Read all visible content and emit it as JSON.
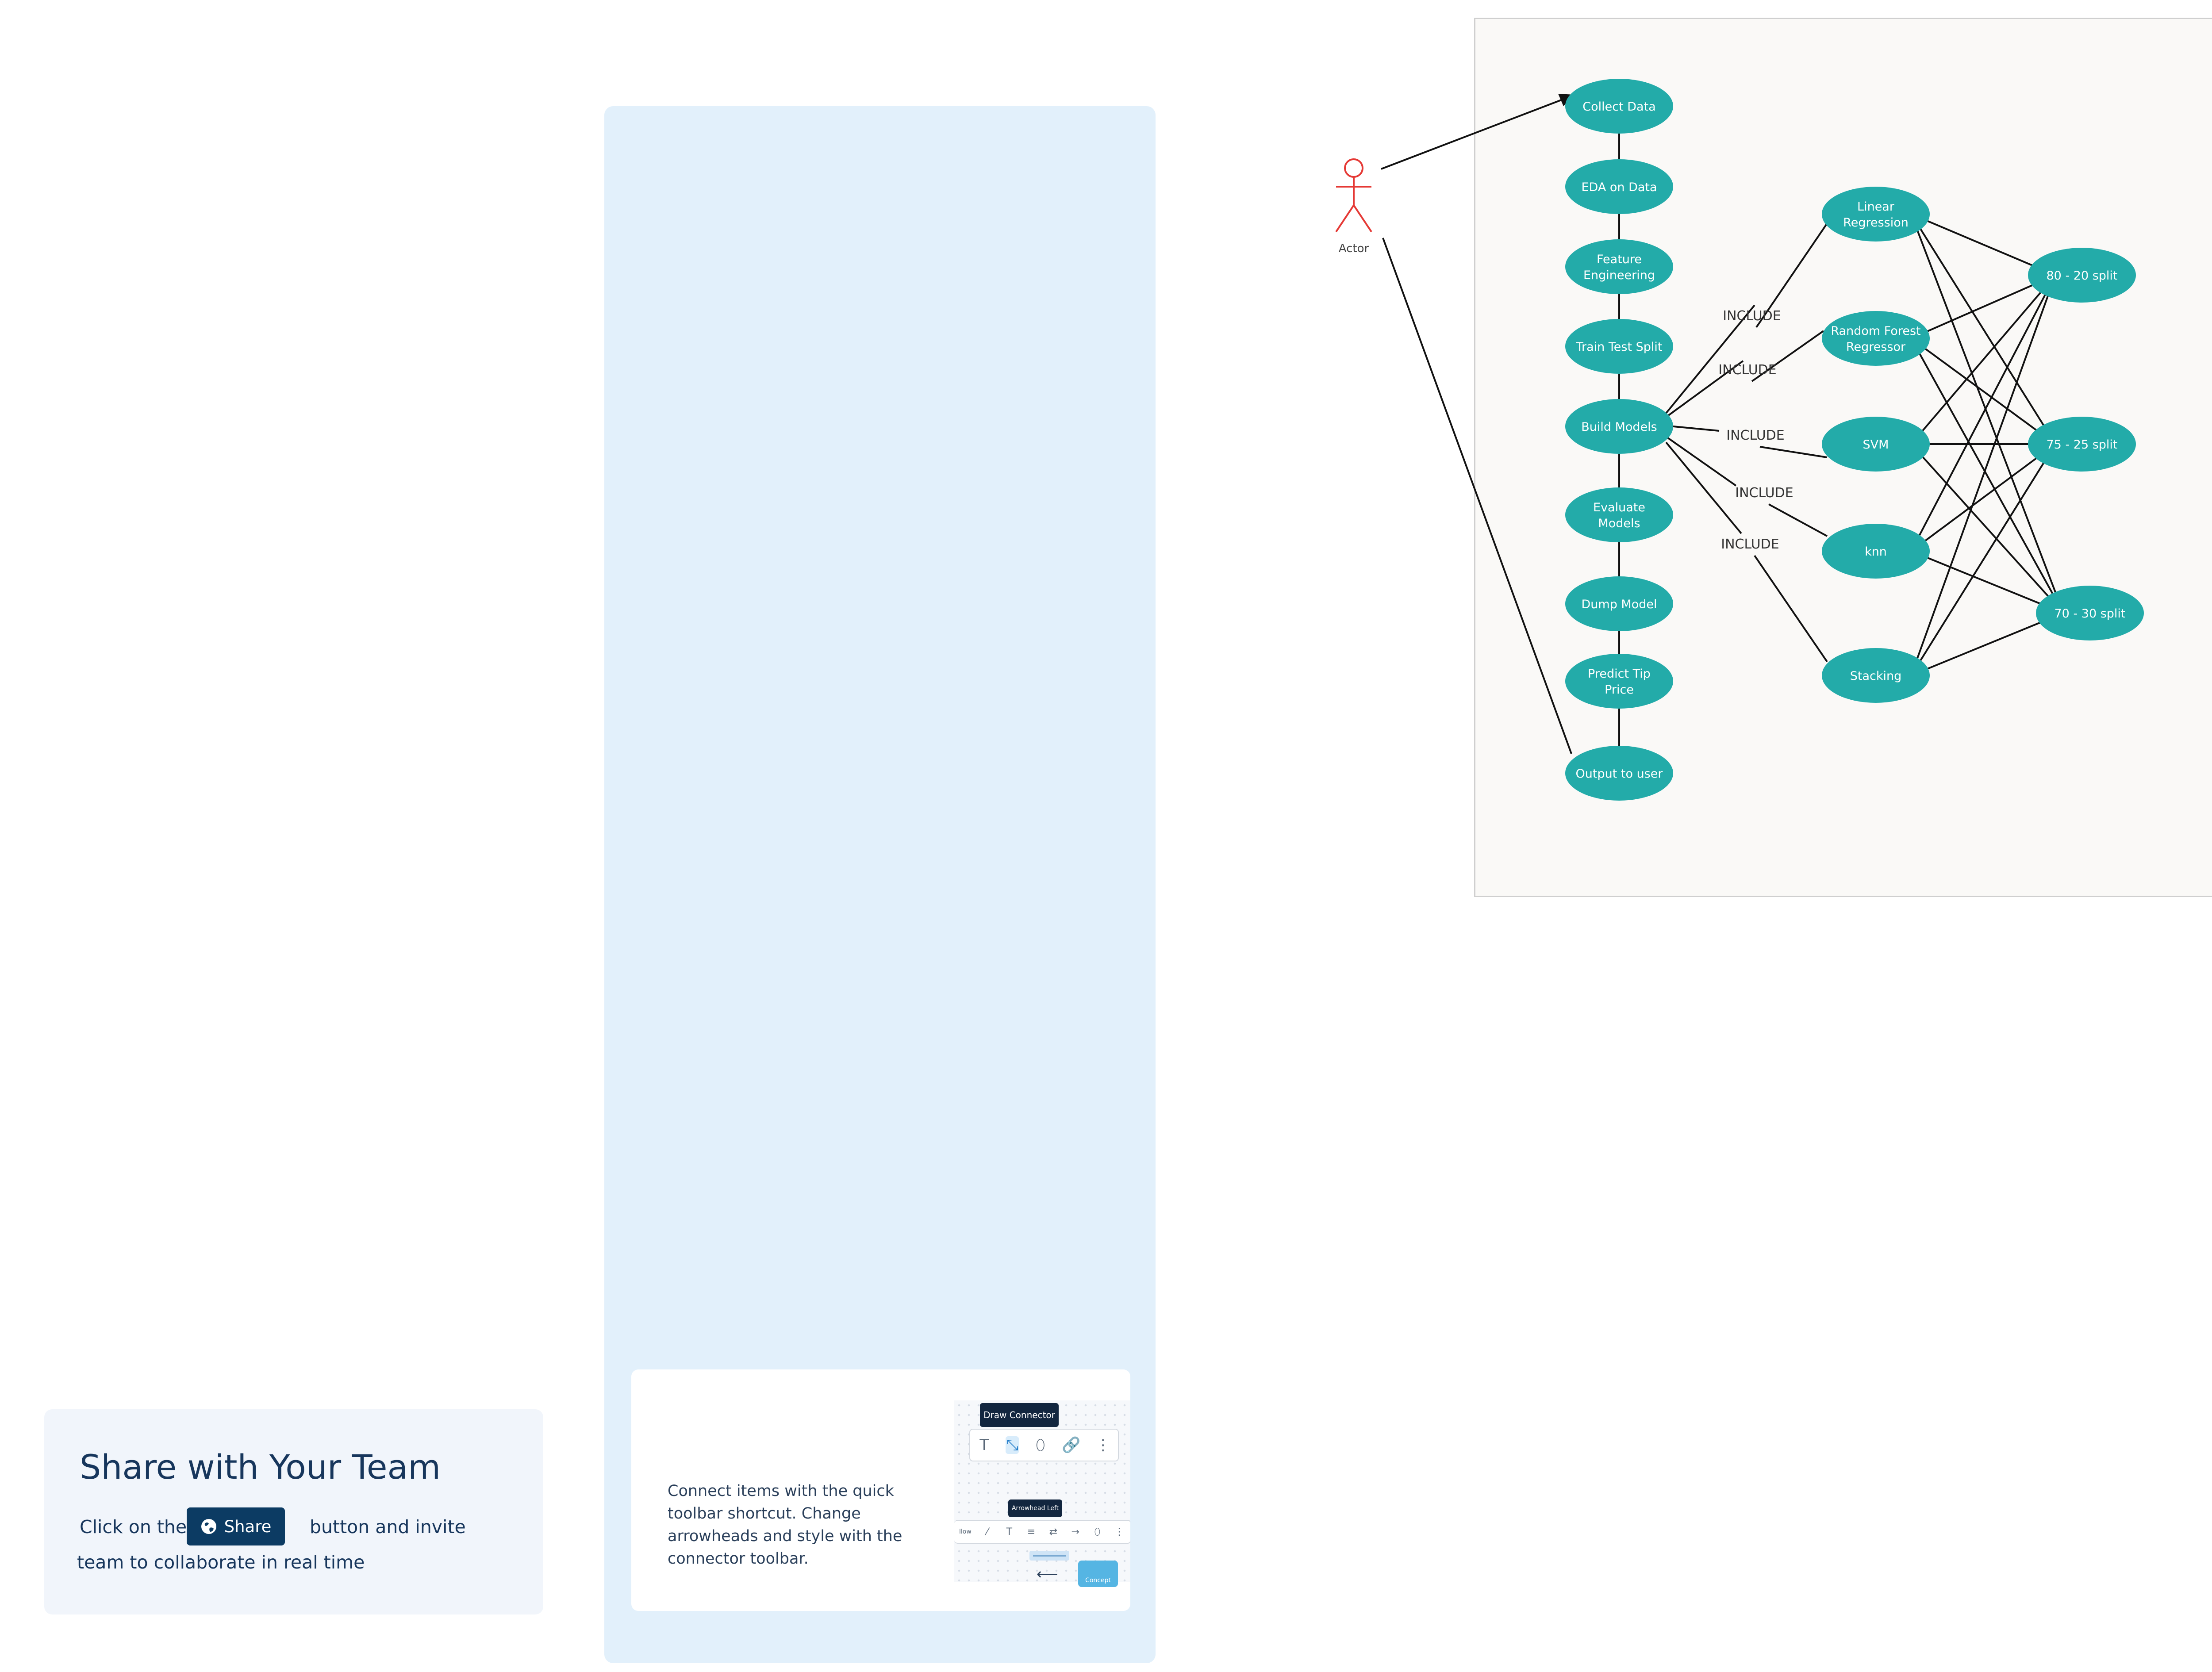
{
  "diagram": {
    "actor": {
      "label": "Actor",
      "color": "#e53935"
    },
    "node_color": "#23aba9",
    "pipeline": [
      {
        "id": "collect",
        "lines": [
          "Collect Data"
        ]
      },
      {
        "id": "eda",
        "lines": [
          "EDA on Data"
        ]
      },
      {
        "id": "feature",
        "lines": [
          "Feature",
          "Engineering"
        ]
      },
      {
        "id": "split",
        "lines": [
          "Train Test Split"
        ]
      },
      {
        "id": "build",
        "lines": [
          "Build Models"
        ]
      },
      {
        "id": "evaluate",
        "lines": [
          "Evaluate",
          "Models"
        ]
      },
      {
        "id": "dump",
        "lines": [
          "Dump Model"
        ]
      },
      {
        "id": "predict",
        "lines": [
          "Predict Tip",
          "Price"
        ]
      },
      {
        "id": "output",
        "lines": [
          "Output to user"
        ]
      }
    ],
    "models": [
      {
        "id": "lr",
        "lines": [
          "Linear",
          "Regression"
        ]
      },
      {
        "id": "rf",
        "lines": [
          "Random Forest",
          "Regressor"
        ]
      },
      {
        "id": "svm",
        "lines": [
          "SVM"
        ]
      },
      {
        "id": "knn",
        "lines": [
          "knn"
        ]
      },
      {
        "id": "stack",
        "lines": [
          "Stacking"
        ]
      }
    ],
    "splits": [
      {
        "id": "s80",
        "lines": [
          "80 - 20 split"
        ]
      },
      {
        "id": "s75",
        "lines": [
          "75 - 25 split"
        ]
      },
      {
        "id": "s70",
        "lines": [
          "70 - 30 split"
        ]
      }
    ],
    "include_label": "INCLUDE"
  },
  "tip": {
    "text": "Connect items with the quick toolbar shortcut. Change arrowheads and style with the connector toolbar.",
    "tooltip_draw": "Draw Connector",
    "tooltip_arrow": "Arrowhead Left",
    "toolbar_label": "llow",
    "concept_label": "Concept",
    "icons": {
      "text": "T",
      "connector": "⤡",
      "shape": "⬯",
      "link": "🔗",
      "more": "⋮"
    }
  },
  "share": {
    "title": "Share with Your Team",
    "line1_prefix": "Click on the",
    "button_label": "Share",
    "line1_suffix": "button and invite",
    "line2": "team to collaborate in real time"
  }
}
